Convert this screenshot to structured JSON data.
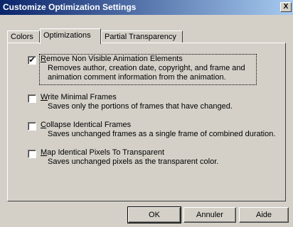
{
  "window": {
    "title": "Customize Optimization Settings",
    "close_glyph": "X"
  },
  "tabs": [
    {
      "label": "Colors",
      "active": false
    },
    {
      "label": "Optimizations",
      "active": true
    },
    {
      "label": "Partial Transparency",
      "active": false
    }
  ],
  "options": [
    {
      "accel": "R",
      "label_rest": "emove Non Visible Animation Elements",
      "checked": true,
      "check_glyph": "✔",
      "desc_lines": [
        "Removes author, creation date, copyright, and frame and",
        "animation comment information from the animation."
      ]
    },
    {
      "accel": "W",
      "label_rest": "rite Minimal Frames",
      "checked": false,
      "check_glyph": "",
      "desc_lines": [
        "Saves only the portions of frames that have changed."
      ]
    },
    {
      "accel": "C",
      "label_rest": "ollapse Identical Frames",
      "checked": false,
      "check_glyph": "",
      "desc_lines": [
        "Saves unchanged frames as a single frame of combined duration."
      ]
    },
    {
      "accel": "M",
      "label_rest": "ap Identical Pixels To Transparent",
      "checked": false,
      "check_glyph": "",
      "desc_lines": [
        "Saves unchanged pixels as the transparent color."
      ]
    }
  ],
  "buttons": {
    "ok": "OK",
    "cancel": "Annuler",
    "help": "Aide"
  },
  "colors": {
    "title_start": "#0a246a",
    "title_end": "#a6caf0",
    "face": "#d4d0c8"
  }
}
